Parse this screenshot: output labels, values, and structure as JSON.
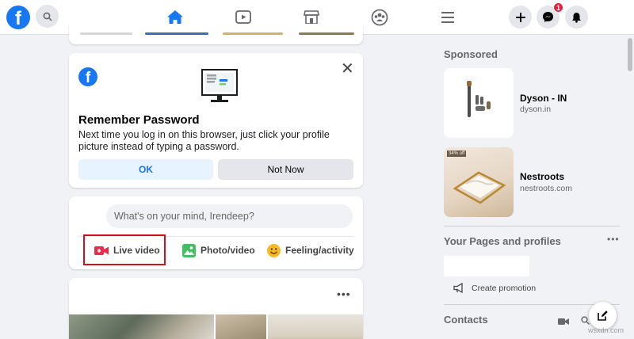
{
  "colors": {
    "accent": "#1877f2",
    "highlight": "#d0101c",
    "background": "#f0f2f5"
  },
  "topbar": {
    "logo_letter": "f",
    "nav_icons": [
      "home-icon",
      "watch-icon",
      "marketplace-icon",
      "groups-icon",
      "menu-icon"
    ],
    "messenger_badge": "1"
  },
  "remember_password": {
    "title": "Remember Password",
    "text": "Next time you log in on this browser, just click your profile picture instead of typing a password.",
    "ok_label": "OK",
    "not_now_label": "Not Now",
    "close_symbol": "✕"
  },
  "composer": {
    "placeholder": "What's on your mind, Irendeep?",
    "actions": [
      {
        "label": "Live video",
        "icon": "live-video-icon"
      },
      {
        "label": "Photo/video",
        "icon": "photo-video-icon"
      },
      {
        "label": "Feeling/activity",
        "icon": "feeling-icon"
      }
    ]
  },
  "post": {
    "more_symbol": "•••"
  },
  "right_rail": {
    "sponsored_heading": "Sponsored",
    "ads": [
      {
        "name": "Dyson - IN",
        "domain": "dyson.in"
      },
      {
        "name": "Nestroots",
        "domain": "nestroots.com",
        "image_tag": "34% off"
      }
    ],
    "pages_heading": "Your Pages and profiles",
    "pages_more": "•••",
    "create_promotion_label": "Create promotion",
    "contacts_heading": "Contacts"
  },
  "watermark": "wsxdn.com"
}
